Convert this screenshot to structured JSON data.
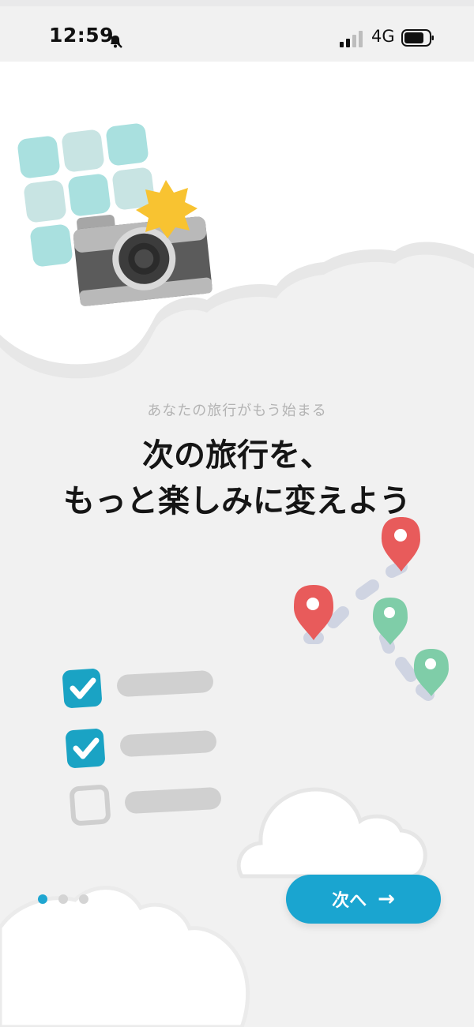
{
  "status_bar": {
    "time": "12:59",
    "network": "4G",
    "icons": [
      "bell-slash-icon",
      "signal-icon",
      "battery-icon"
    ]
  },
  "onboarding": {
    "subtitle": "あなたの旅行がもう始まる",
    "headline_line1": "次の旅行を、",
    "headline_line2": "もっと楽しみに変えよう",
    "page_index": 1,
    "page_count": 3
  },
  "actions": {
    "next_label": "次へ",
    "next_icon": "arrow-right-icon"
  },
  "colors": {
    "accent": "#1aa5d0",
    "pin_red": "#e85b5b",
    "pin_green": "#7fcda8",
    "tile": "#a9e0df",
    "check": "#1aa3c4"
  }
}
